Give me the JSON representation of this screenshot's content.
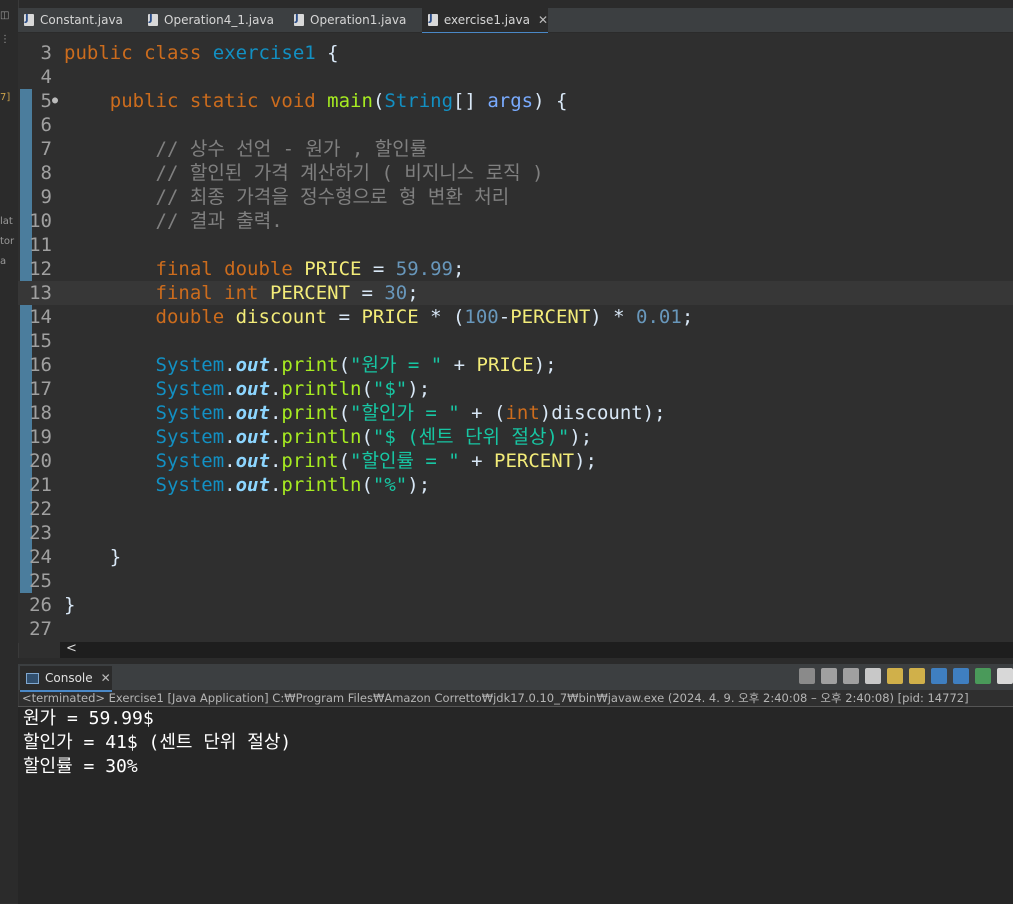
{
  "left_strip": {
    "labels": [
      "lat",
      "tor",
      "a",
      "7]"
    ]
  },
  "tabs": [
    {
      "label": "Constant.java",
      "active": false
    },
    {
      "label": "Operation4_1.java",
      "active": false
    },
    {
      "label": "Operation1.java",
      "active": false
    },
    {
      "label": "exercise1.java",
      "active": true
    }
  ],
  "editor": {
    "lines": [
      {
        "n": "3",
        "tokens": [
          [
            "kw",
            "public"
          ],
          [
            "plain",
            " "
          ],
          [
            "kw",
            "class"
          ],
          [
            "plain",
            " "
          ],
          [
            "type",
            "exercise1"
          ],
          [
            "plain",
            " {"
          ]
        ]
      },
      {
        "n": "4",
        "tokens": []
      },
      {
        "n": "5",
        "marker": "●",
        "tokens": [
          [
            "plain",
            "    "
          ],
          [
            "kw",
            "public"
          ],
          [
            "plain",
            " "
          ],
          [
            "kw",
            "static"
          ],
          [
            "plain",
            " "
          ],
          [
            "kw",
            "void"
          ],
          [
            "plain",
            " "
          ],
          [
            "fn",
            "main"
          ],
          [
            "plain",
            "("
          ],
          [
            "cls",
            "String"
          ],
          [
            "plain",
            "[] "
          ],
          [
            "param",
            "args"
          ],
          [
            "plain",
            ") {"
          ]
        ]
      },
      {
        "n": "6",
        "tokens": []
      },
      {
        "n": "7",
        "tokens": [
          [
            "plain",
            "        "
          ],
          [
            "cmt",
            "// 상수 선언 - 원가 , 할인률"
          ]
        ]
      },
      {
        "n": "8",
        "tokens": [
          [
            "plain",
            "        "
          ],
          [
            "cmt",
            "// 할인된 가격 계산하기 ( 비지니스 로직 )"
          ]
        ]
      },
      {
        "n": "9",
        "tokens": [
          [
            "plain",
            "        "
          ],
          [
            "cmt",
            "// 최종 가격을 정수형으로 형 변환 처리"
          ]
        ]
      },
      {
        "n": "10",
        "tokens": [
          [
            "plain",
            "        "
          ],
          [
            "cmt",
            "// 결과 출력."
          ]
        ]
      },
      {
        "n": "11",
        "tokens": []
      },
      {
        "n": "12",
        "tokens": [
          [
            "plain",
            "        "
          ],
          [
            "kw",
            "final"
          ],
          [
            "plain",
            " "
          ],
          [
            "kw",
            "double"
          ],
          [
            "plain",
            " "
          ],
          [
            "var",
            "PRICE"
          ],
          [
            "plain",
            " = "
          ],
          [
            "num",
            "59.99"
          ],
          [
            "plain",
            ";"
          ]
        ]
      },
      {
        "n": "13",
        "current": true,
        "tokens": [
          [
            "plain",
            "        "
          ],
          [
            "kw",
            "final"
          ],
          [
            "plain",
            " "
          ],
          [
            "kw",
            "int"
          ],
          [
            "plain",
            " "
          ],
          [
            "var",
            "PERCENT"
          ],
          [
            "plain",
            " = "
          ],
          [
            "num",
            "30"
          ],
          [
            "plain",
            ";"
          ]
        ]
      },
      {
        "n": "14",
        "tokens": [
          [
            "plain",
            "        "
          ],
          [
            "kw",
            "double"
          ],
          [
            "plain",
            " "
          ],
          [
            "var",
            "discount"
          ],
          [
            "plain",
            " = "
          ],
          [
            "var",
            "PRICE"
          ],
          [
            "plain",
            " * ("
          ],
          [
            "num",
            "100"
          ],
          [
            "plain",
            "-"
          ],
          [
            "var",
            "PERCENT"
          ],
          [
            "plain",
            ") * "
          ],
          [
            "num",
            "0.01"
          ],
          [
            "plain",
            ";"
          ]
        ]
      },
      {
        "n": "15",
        "tokens": []
      },
      {
        "n": "16",
        "tokens": [
          [
            "plain",
            "        "
          ],
          [
            "cls",
            "System"
          ],
          [
            "plain",
            "."
          ],
          [
            "sout",
            "out"
          ],
          [
            "plain",
            "."
          ],
          [
            "fn",
            "print"
          ],
          [
            "plain",
            "("
          ],
          [
            "str",
            "\"원가 = \""
          ],
          [
            "plain",
            " + "
          ],
          [
            "var",
            "PRICE"
          ],
          [
            "plain",
            ");"
          ]
        ]
      },
      {
        "n": "17",
        "tokens": [
          [
            "plain",
            "        "
          ],
          [
            "cls",
            "System"
          ],
          [
            "plain",
            "."
          ],
          [
            "sout",
            "out"
          ],
          [
            "plain",
            "."
          ],
          [
            "fn",
            "println"
          ],
          [
            "plain",
            "("
          ],
          [
            "str",
            "\"$\""
          ],
          [
            "plain",
            ");"
          ]
        ]
      },
      {
        "n": "18",
        "tokens": [
          [
            "plain",
            "        "
          ],
          [
            "cls",
            "System"
          ],
          [
            "plain",
            "."
          ],
          [
            "sout",
            "out"
          ],
          [
            "plain",
            "."
          ],
          [
            "fn",
            "print"
          ],
          [
            "plain",
            "("
          ],
          [
            "str",
            "\"할인가 = \""
          ],
          [
            "plain",
            " + ("
          ],
          [
            "kw",
            "int"
          ],
          [
            "plain",
            ")discount);"
          ]
        ]
      },
      {
        "n": "19",
        "tokens": [
          [
            "plain",
            "        "
          ],
          [
            "cls",
            "System"
          ],
          [
            "plain",
            "."
          ],
          [
            "sout",
            "out"
          ],
          [
            "plain",
            "."
          ],
          [
            "fn",
            "println"
          ],
          [
            "plain",
            "("
          ],
          [
            "str",
            "\"$ (센트 단위 절상)\""
          ],
          [
            "plain",
            ");"
          ]
        ]
      },
      {
        "n": "20",
        "tokens": [
          [
            "plain",
            "        "
          ],
          [
            "cls",
            "System"
          ],
          [
            "plain",
            "."
          ],
          [
            "sout",
            "out"
          ],
          [
            "plain",
            "."
          ],
          [
            "fn",
            "print"
          ],
          [
            "plain",
            "("
          ],
          [
            "str",
            "\"할인률 = \""
          ],
          [
            "plain",
            " + "
          ],
          [
            "var",
            "PERCENT"
          ],
          [
            "plain",
            ");"
          ]
        ]
      },
      {
        "n": "21",
        "tokens": [
          [
            "plain",
            "        "
          ],
          [
            "cls",
            "System"
          ],
          [
            "plain",
            "."
          ],
          [
            "sout",
            "out"
          ],
          [
            "plain",
            "."
          ],
          [
            "fn",
            "println"
          ],
          [
            "plain",
            "("
          ],
          [
            "str",
            "\"%\""
          ],
          [
            "plain",
            ");"
          ]
        ]
      },
      {
        "n": "22",
        "tokens": []
      },
      {
        "n": "23",
        "tokens": []
      },
      {
        "n": "24",
        "tokens": [
          [
            "plain",
            "    }"
          ]
        ]
      },
      {
        "n": "25",
        "tokens": []
      },
      {
        "n": "26",
        "tokens": [
          [
            "plain",
            "}"
          ]
        ]
      },
      {
        "n": "27",
        "tokens": []
      }
    ]
  },
  "hscroll": {
    "arrow": "<"
  },
  "console": {
    "tab_label": "Console",
    "status": "<terminated> Exercise1 [Java Application] C:₩Program Files₩Amazon Corretto₩jdk17.0.10_7₩bin₩javaw.exe  (2024. 4. 9. 오후 2:40:08 – 오후 2:40:08) [pid: 14772]",
    "output": [
      "원가 = 59.99$",
      "할인가 = 41$ (센트 단위 절상)",
      "할인률 = 30%"
    ],
    "toolbar_icons": [
      "terminate-icon",
      "remove-launch-icon",
      "remove-all-icon",
      "scroll-lock-icon",
      "word-wrap-icon",
      "show-on-output-icon",
      "pin-console-icon",
      "display-console-icon",
      "open-console-icon",
      "new-console-icon"
    ]
  },
  "colors": {
    "editor_bg": "#2f2f2f",
    "accent": "#4a88c7",
    "keyword": "#cc6c1d",
    "string": "#17c6a3"
  }
}
